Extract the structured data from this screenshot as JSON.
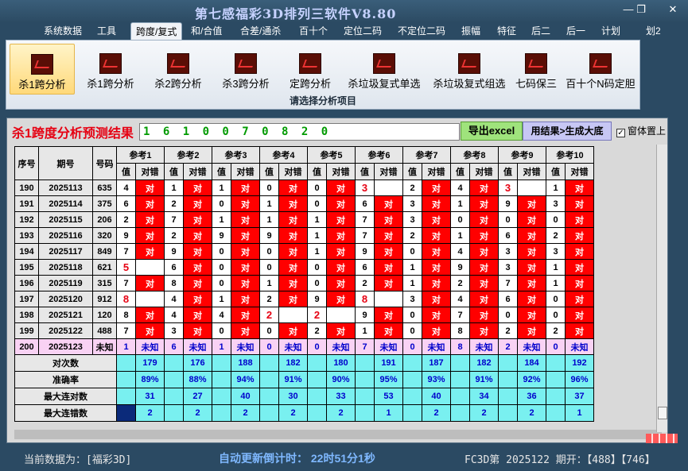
{
  "window": {
    "title": "第七感福彩3D排列三软件V8.80"
  },
  "menu": [
    "系统数据",
    "工具",
    "跨度/复式",
    "和/合值",
    "合差/通杀",
    "百十个",
    "定位二码",
    "不定位二码",
    "振幅",
    "特征",
    "后二",
    "后一",
    "计划",
    "划2"
  ],
  "menu_active": 2,
  "ribbon": {
    "buttons": [
      "杀1跨分析",
      "杀1跨分析",
      "杀2跨分析",
      "杀3跨分析",
      "定跨分析",
      "杀垃圾复式单选",
      "杀垃圾复式组选",
      "七码保三",
      "百十个N码定胆"
    ],
    "selected": 0,
    "caption": "请选择分析项目"
  },
  "analysis": {
    "title": "杀1跨度分析预测结果",
    "prediction": "1 6 1 0 0 7 0 8 2 0",
    "export_label": "导出excel",
    "generate_label": "用结果>生成大底",
    "pin_label": "窗体置上",
    "pin_checked": "✓"
  },
  "table": {
    "head_seq": "序号",
    "head_period": "期号",
    "head_num": "号码",
    "refs": [
      "参考1",
      "参考2",
      "参考3",
      "参考4",
      "参考5",
      "参考6",
      "参考7",
      "参考8",
      "参考9",
      "参考10"
    ],
    "sub_val": "值",
    "sub_res": "对错",
    "dui": "对",
    "rows": [
      {
        "seq": "190",
        "period": "2025113",
        "num": "635",
        "vals": [
          "4",
          "1",
          "1",
          "0",
          "0",
          "3",
          "2",
          "4",
          "3",
          "1"
        ],
        "ok": [
          1,
          1,
          1,
          1,
          1,
          0,
          1,
          1,
          0,
          1
        ]
      },
      {
        "seq": "191",
        "period": "2025114",
        "num": "375",
        "vals": [
          "6",
          "2",
          "0",
          "1",
          "0",
          "6",
          "3",
          "1",
          "9",
          "3"
        ],
        "ok": [
          1,
          1,
          1,
          1,
          1,
          1,
          1,
          1,
          1,
          1
        ]
      },
      {
        "seq": "192",
        "period": "2025115",
        "num": "206",
        "vals": [
          "2",
          "7",
          "1",
          "1",
          "1",
          "7",
          "3",
          "0",
          "0",
          "0"
        ],
        "ok": [
          1,
          1,
          1,
          1,
          1,
          1,
          1,
          1,
          1,
          1
        ]
      },
      {
        "seq": "193",
        "period": "2025116",
        "num": "320",
        "vals": [
          "9",
          "2",
          "9",
          "9",
          "1",
          "7",
          "2",
          "1",
          "6",
          "2"
        ],
        "ok": [
          1,
          1,
          1,
          1,
          1,
          1,
          1,
          1,
          1,
          1
        ]
      },
      {
        "seq": "194",
        "period": "2025117",
        "num": "849",
        "vals": [
          "7",
          "9",
          "0",
          "0",
          "1",
          "9",
          "0",
          "4",
          "3",
          "3"
        ],
        "ok": [
          1,
          1,
          1,
          1,
          1,
          1,
          1,
          1,
          1,
          1
        ]
      },
      {
        "seq": "195",
        "period": "2025118",
        "num": "621",
        "vals": [
          "5",
          "6",
          "0",
          "0",
          "0",
          "6",
          "1",
          "9",
          "3",
          "1"
        ],
        "ok": [
          0,
          1,
          1,
          1,
          1,
          1,
          1,
          1,
          1,
          1
        ]
      },
      {
        "seq": "196",
        "period": "2025119",
        "num": "315",
        "vals": [
          "7",
          "8",
          "0",
          "1",
          "0",
          "2",
          "1",
          "2",
          "7",
          "1"
        ],
        "ok": [
          1,
          1,
          1,
          1,
          1,
          1,
          1,
          1,
          1,
          1
        ]
      },
      {
        "seq": "197",
        "period": "2025120",
        "num": "912",
        "vals": [
          "8",
          "4",
          "1",
          "2",
          "9",
          "8",
          "3",
          "4",
          "6",
          "0"
        ],
        "ok": [
          0,
          1,
          1,
          1,
          1,
          0,
          1,
          1,
          1,
          1
        ]
      },
      {
        "seq": "198",
        "period": "2025121",
        "num": "120",
        "vals": [
          "8",
          "4",
          "4",
          "2",
          "2",
          "9",
          "0",
          "7",
          "0",
          "0"
        ],
        "ok": [
          1,
          1,
          1,
          0,
          0,
          1,
          1,
          1,
          1,
          1
        ]
      },
      {
        "seq": "199",
        "period": "2025122",
        "num": "488",
        "vals": [
          "7",
          "3",
          "0",
          "0",
          "2",
          "1",
          "0",
          "8",
          "2",
          "2"
        ],
        "ok": [
          1,
          1,
          1,
          1,
          1,
          1,
          1,
          1,
          1,
          1
        ]
      }
    ],
    "last": {
      "seq": "200",
      "period": "2025123",
      "num": "未知",
      "vals": [
        "1",
        "6",
        "1",
        "0",
        "0",
        "7",
        "0",
        "8",
        "2",
        "0"
      ],
      "unk": "未知"
    },
    "stats": [
      {
        "label": "对次数",
        "vals": [
          "179",
          "176",
          "188",
          "182",
          "180",
          "191",
          "187",
          "182",
          "184",
          "192"
        ]
      },
      {
        "label": "准确率",
        "vals": [
          "89%",
          "88%",
          "94%",
          "91%",
          "90%",
          "95%",
          "93%",
          "91%",
          "92%",
          "96%"
        ]
      },
      {
        "label": "最大连对数",
        "vals": [
          "31",
          "27",
          "40",
          "30",
          "33",
          "53",
          "40",
          "34",
          "36",
          "37"
        ]
      },
      {
        "label": "最大连错数",
        "vals": [
          "2",
          "2",
          "2",
          "2",
          "2",
          "1",
          "2",
          "2",
          "2",
          "1"
        ]
      }
    ]
  },
  "status": {
    "current": "当前数据为：[福彩3D]",
    "countdown": "自动更新倒计时： 22时51分1秒",
    "draw": "FC3D第 2025122 期开：【488】【746】"
  },
  "colors": {
    "correct": "#ff0000",
    "last_row": "#f9d2f4",
    "stats": "#79f0f0",
    "prediction": "#009a00",
    "accent": "#e60012"
  }
}
